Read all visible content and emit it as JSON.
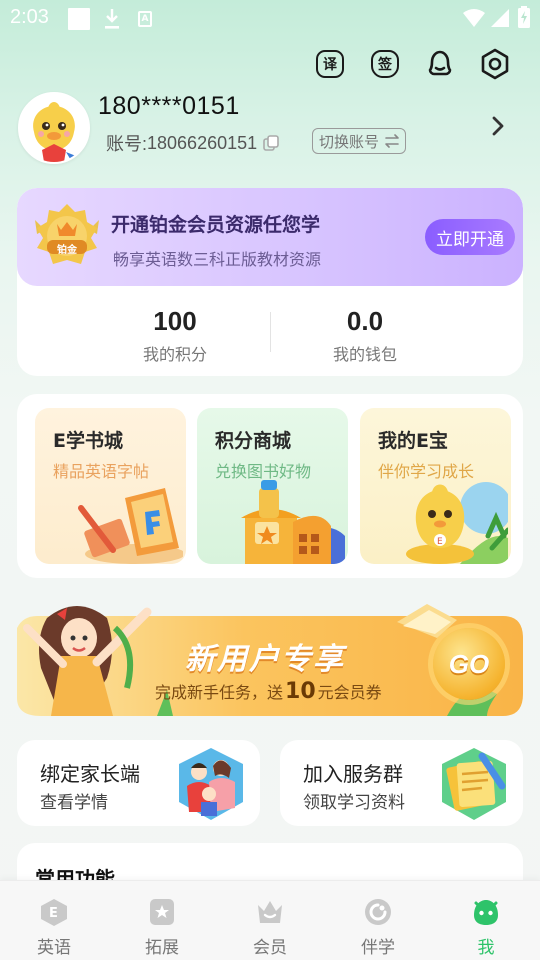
{
  "status_bar": {
    "time": "2:03"
  },
  "profile": {
    "username": "180****0151",
    "account_prefix": "账号: ",
    "account_number": "18066260151",
    "switch_label": "切换账号"
  },
  "toolbar": {
    "translate_glyph": "译",
    "sign_glyph": "签"
  },
  "vip": {
    "badge_text": "铂金",
    "title": "开通铂金会员资源任您学",
    "subtitle": "畅享英语数三科正版教材资源",
    "button": "立即开通"
  },
  "stats": {
    "points_value": "100",
    "points_label": "我的积分",
    "wallet_value": "0.0",
    "wallet_label": "我的钱包"
  },
  "features": [
    {
      "title": "E学书城",
      "subtitle": "精品英语字帖"
    },
    {
      "title": "积分商城",
      "subtitle": "兑换图书好物"
    },
    {
      "title": "我的E宝",
      "subtitle": "伴你学习成长"
    }
  ],
  "new_user": {
    "title": "新用户专享",
    "desc_before": "完成新手任务，送",
    "amount": "10",
    "desc_after": "元会员券",
    "go_label": "GO"
  },
  "cards": [
    {
      "title": "绑定家长端",
      "subtitle": "查看学情"
    },
    {
      "title": "加入服务群",
      "subtitle": "领取学习资料"
    }
  ],
  "common": {
    "title": "常用功能"
  },
  "nav": [
    {
      "label": "英语",
      "icon": "english-icon"
    },
    {
      "label": "拓展",
      "icon": "star-icon"
    },
    {
      "label": "会员",
      "icon": "crown-icon"
    },
    {
      "label": "伴学",
      "icon": "companion-icon"
    },
    {
      "label": "我",
      "icon": "me-icon",
      "active": true
    }
  ],
  "colors": {
    "accent_green": "#2ec36a",
    "vip_purple": "#8a5dff",
    "banner_orange": "#fbb64d"
  }
}
